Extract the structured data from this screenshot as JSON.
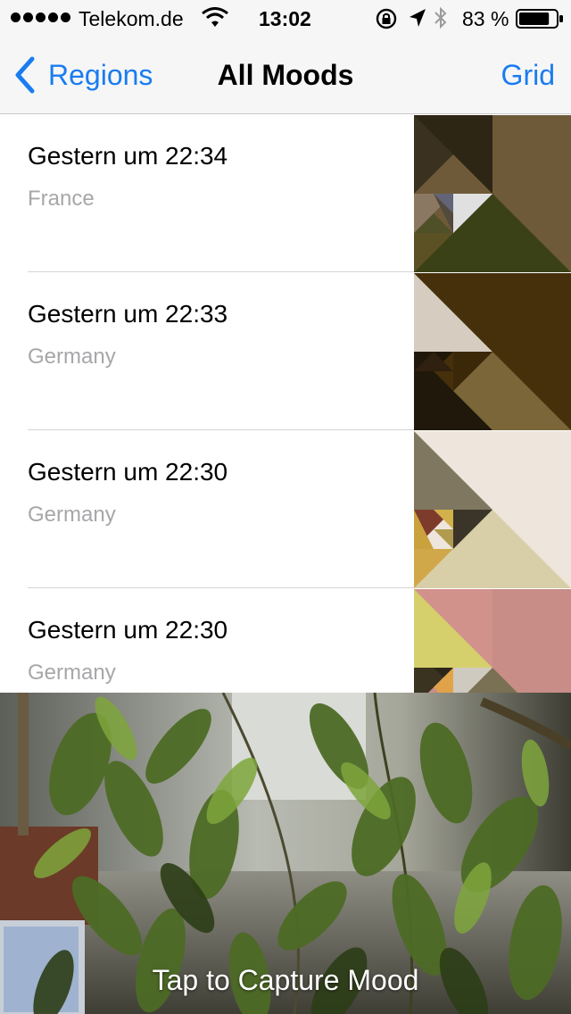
{
  "status_bar": {
    "carrier": "Telekom.de",
    "time": "13:02",
    "battery": "83 %",
    "battery_level": 0.83,
    "icons": [
      "signal-dots-icon",
      "wifi-icon",
      "rotation-lock-icon",
      "location-arrow-icon",
      "bluetooth-icon",
      "battery-icon"
    ]
  },
  "nav": {
    "back_label": "Regions",
    "title": "All Moods",
    "right_label": "Grid"
  },
  "moods": [
    {
      "title": "Gestern um 22:34",
      "region": "France"
    },
    {
      "title": "Gestern um 22:33",
      "region": "Germany"
    },
    {
      "title": "Gestern um 22:30",
      "region": "Germany"
    },
    {
      "title": "Gestern um 22:30",
      "region": "Germany"
    }
  ],
  "camera": {
    "prompt": "Tap to Capture Mood"
  },
  "colors": {
    "accent": "#1a7cf0",
    "secondary_text": "#a7a7aa"
  }
}
